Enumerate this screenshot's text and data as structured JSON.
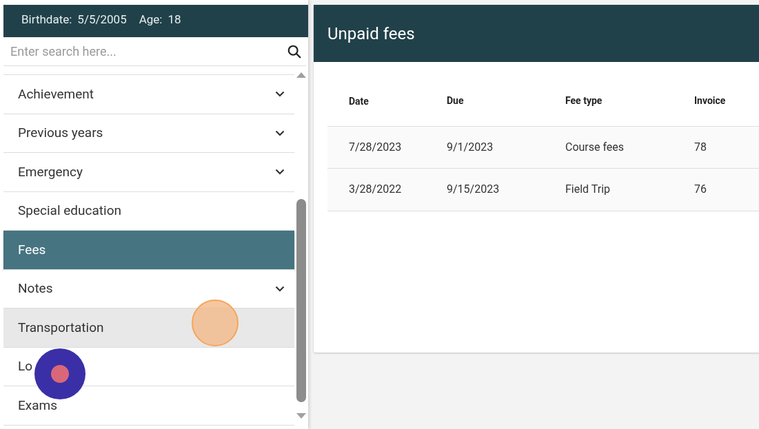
{
  "student": {
    "birthdate_label": "Birthdate:",
    "birthdate": "5/5/2005",
    "age_label": "Age:",
    "age": "18"
  },
  "search": {
    "placeholder": "Enter search here..."
  },
  "menu": [
    {
      "label": "Achievement",
      "expandable": true,
      "selected": false,
      "hovered": false
    },
    {
      "label": "Previous years",
      "expandable": true,
      "selected": false,
      "hovered": false
    },
    {
      "label": "Emergency",
      "expandable": true,
      "selected": false,
      "hovered": false
    },
    {
      "label": "Special education",
      "expandable": false,
      "selected": false,
      "hovered": false
    },
    {
      "label": "Fees",
      "expandable": false,
      "selected": true,
      "hovered": false
    },
    {
      "label": "Notes",
      "expandable": true,
      "selected": false,
      "hovered": false
    },
    {
      "label": "Transportation",
      "expandable": false,
      "selected": false,
      "hovered": true
    },
    {
      "label": "Lo",
      "expandable": false,
      "selected": false,
      "hovered": false
    },
    {
      "label": "Exams",
      "expandable": false,
      "selected": false,
      "hovered": false
    }
  ],
  "card": {
    "title": "Unpaid fees"
  },
  "table": {
    "columns": [
      "Date",
      "Due",
      "Fee type",
      "Invoice"
    ],
    "rows": [
      [
        "7/28/2023",
        "9/1/2023",
        "Course fees",
        "78"
      ],
      [
        "3/28/2022",
        "9/15/2023",
        "Field Trip",
        "76"
      ]
    ]
  }
}
